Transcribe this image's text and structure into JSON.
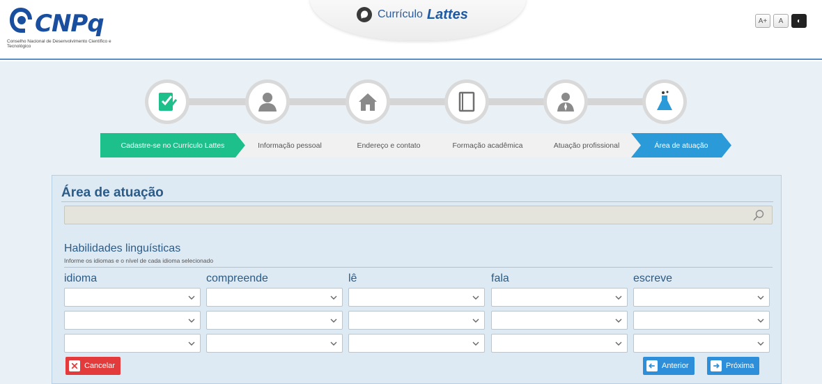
{
  "header": {
    "logo_text": "CNPq",
    "logo_subtitle": "Conselho Nacional de Desenvolvimento Científico e Tecnológico",
    "brand_prefix": "Currículo",
    "brand_name": "Lattes",
    "accessibility": {
      "increase_font": "A+",
      "normal_font": "A",
      "contrast": "◐"
    }
  },
  "steps": [
    {
      "icon": "edit-document-icon"
    },
    {
      "icon": "person-icon"
    },
    {
      "icon": "house-icon"
    },
    {
      "icon": "book-icon"
    },
    {
      "icon": "professional-icon"
    },
    {
      "icon": "flask-icon"
    }
  ],
  "breadcrumb": [
    {
      "label": "Cadastre-se no Currículo Lattes"
    },
    {
      "label": "Informação pessoal"
    },
    {
      "label": "Endereço e contato"
    },
    {
      "label": "Formação acadêmica"
    },
    {
      "label": "Atuação profissional"
    },
    {
      "label": "Área de atuação"
    }
  ],
  "panel": {
    "title": "Área de atuação",
    "search": {
      "value": ""
    },
    "languages": {
      "title": "Habilidades linguísticas",
      "subtitle": "Informe os idiomas e o nível de cada idioma selecionado",
      "columns": [
        "idioma",
        "compreende",
        "lê",
        "fala",
        "escreve"
      ],
      "rows": [
        [
          "",
          "",
          "",
          "",
          ""
        ],
        [
          "",
          "",
          "",
          "",
          ""
        ],
        [
          "",
          "",
          "",
          "",
          ""
        ]
      ]
    },
    "buttons": {
      "cancel": "Cancelar",
      "previous": "Anterior",
      "next": "Próxima"
    }
  },
  "colors": {
    "primary": "#2a9ad8",
    "success": "#1dbf8a",
    "danger": "#e33b3b",
    "heading": "#2b5b86"
  }
}
